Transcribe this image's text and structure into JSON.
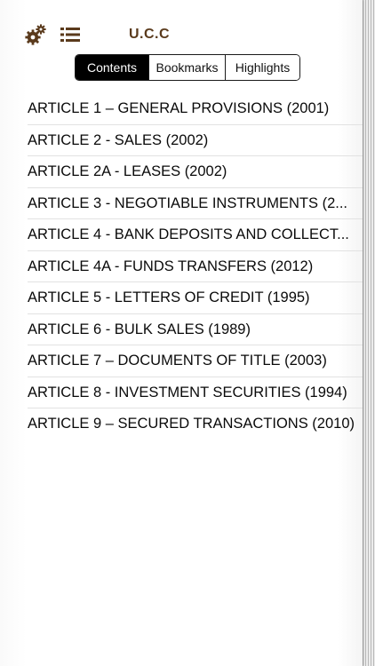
{
  "header": {
    "title": "U.C.C",
    "settings_icon": "gears-icon",
    "toc_icon": "list-icon",
    "accent_color": "#5a3a1c"
  },
  "tabs": [
    {
      "label": "Contents",
      "active": true
    },
    {
      "label": "Bookmarks",
      "active": false
    },
    {
      "label": "Highlights",
      "active": false
    }
  ],
  "articles": [
    {
      "label": "ARTICLE 1 – GENERAL PROVISIONS (2001)"
    },
    {
      "label": "ARTICLE 2 - SALES (2002)"
    },
    {
      "label": "ARTICLE 2A - LEASES (2002)"
    },
    {
      "label": "ARTICLE 3 - NEGOTIABLE INSTRUMENTS (2..."
    },
    {
      "label": "ARTICLE 4 - BANK DEPOSITS AND COLLECT..."
    },
    {
      "label": "ARTICLE 4A - FUNDS TRANSFERS (2012)"
    },
    {
      "label": "ARTICLE 5 - LETTERS OF CREDIT (1995)"
    },
    {
      "label": "ARTICLE 6 - BULK SALES (1989)"
    },
    {
      "label": "ARTICLE 7 – DOCUMENTS OF TITLE (2003)"
    },
    {
      "label": "ARTICLE 8 - INVESTMENT SECURITIES (1994)"
    },
    {
      "label": "ARTICLE 9 – SECURED TRANSACTIONS (2010)"
    }
  ]
}
